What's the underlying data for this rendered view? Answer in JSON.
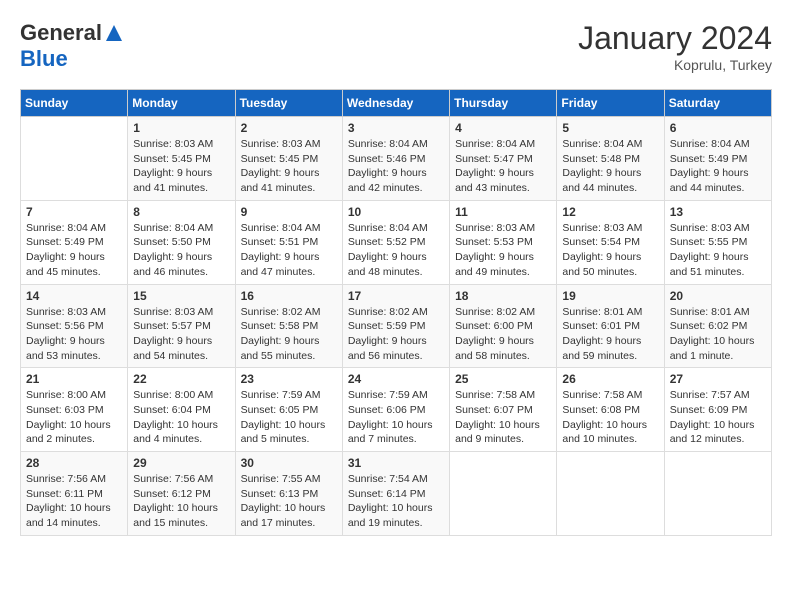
{
  "logo": {
    "general": "General",
    "blue": "Blue"
  },
  "header": {
    "month_year": "January 2024",
    "location": "Koprulu, Turkey"
  },
  "days_of_week": [
    "Sunday",
    "Monday",
    "Tuesday",
    "Wednesday",
    "Thursday",
    "Friday",
    "Saturday"
  ],
  "weeks": [
    [
      {
        "day": "",
        "sunrise": "",
        "sunset": "",
        "daylight": ""
      },
      {
        "day": "1",
        "sunrise": "Sunrise: 8:03 AM",
        "sunset": "Sunset: 5:45 PM",
        "daylight": "Daylight: 9 hours and 41 minutes."
      },
      {
        "day": "2",
        "sunrise": "Sunrise: 8:03 AM",
        "sunset": "Sunset: 5:45 PM",
        "daylight": "Daylight: 9 hours and 41 minutes."
      },
      {
        "day": "3",
        "sunrise": "Sunrise: 8:04 AM",
        "sunset": "Sunset: 5:46 PM",
        "daylight": "Daylight: 9 hours and 42 minutes."
      },
      {
        "day": "4",
        "sunrise": "Sunrise: 8:04 AM",
        "sunset": "Sunset: 5:47 PM",
        "daylight": "Daylight: 9 hours and 43 minutes."
      },
      {
        "day": "5",
        "sunrise": "Sunrise: 8:04 AM",
        "sunset": "Sunset: 5:48 PM",
        "daylight": "Daylight: 9 hours and 44 minutes."
      },
      {
        "day": "6",
        "sunrise": "Sunrise: 8:04 AM",
        "sunset": "Sunset: 5:49 PM",
        "daylight": "Daylight: 9 hours and 44 minutes."
      }
    ],
    [
      {
        "day": "7",
        "sunrise": "Sunrise: 8:04 AM",
        "sunset": "Sunset: 5:49 PM",
        "daylight": "Daylight: 9 hours and 45 minutes."
      },
      {
        "day": "8",
        "sunrise": "Sunrise: 8:04 AM",
        "sunset": "Sunset: 5:50 PM",
        "daylight": "Daylight: 9 hours and 46 minutes."
      },
      {
        "day": "9",
        "sunrise": "Sunrise: 8:04 AM",
        "sunset": "Sunset: 5:51 PM",
        "daylight": "Daylight: 9 hours and 47 minutes."
      },
      {
        "day": "10",
        "sunrise": "Sunrise: 8:04 AM",
        "sunset": "Sunset: 5:52 PM",
        "daylight": "Daylight: 9 hours and 48 minutes."
      },
      {
        "day": "11",
        "sunrise": "Sunrise: 8:03 AM",
        "sunset": "Sunset: 5:53 PM",
        "daylight": "Daylight: 9 hours and 49 minutes."
      },
      {
        "day": "12",
        "sunrise": "Sunrise: 8:03 AM",
        "sunset": "Sunset: 5:54 PM",
        "daylight": "Daylight: 9 hours and 50 minutes."
      },
      {
        "day": "13",
        "sunrise": "Sunrise: 8:03 AM",
        "sunset": "Sunset: 5:55 PM",
        "daylight": "Daylight: 9 hours and 51 minutes."
      }
    ],
    [
      {
        "day": "14",
        "sunrise": "Sunrise: 8:03 AM",
        "sunset": "Sunset: 5:56 PM",
        "daylight": "Daylight: 9 hours and 53 minutes."
      },
      {
        "day": "15",
        "sunrise": "Sunrise: 8:03 AM",
        "sunset": "Sunset: 5:57 PM",
        "daylight": "Daylight: 9 hours and 54 minutes."
      },
      {
        "day": "16",
        "sunrise": "Sunrise: 8:02 AM",
        "sunset": "Sunset: 5:58 PM",
        "daylight": "Daylight: 9 hours and 55 minutes."
      },
      {
        "day": "17",
        "sunrise": "Sunrise: 8:02 AM",
        "sunset": "Sunset: 5:59 PM",
        "daylight": "Daylight: 9 hours and 56 minutes."
      },
      {
        "day": "18",
        "sunrise": "Sunrise: 8:02 AM",
        "sunset": "Sunset: 6:00 PM",
        "daylight": "Daylight: 9 hours and 58 minutes."
      },
      {
        "day": "19",
        "sunrise": "Sunrise: 8:01 AM",
        "sunset": "Sunset: 6:01 PM",
        "daylight": "Daylight: 9 hours and 59 minutes."
      },
      {
        "day": "20",
        "sunrise": "Sunrise: 8:01 AM",
        "sunset": "Sunset: 6:02 PM",
        "daylight": "Daylight: 10 hours and 1 minute."
      }
    ],
    [
      {
        "day": "21",
        "sunrise": "Sunrise: 8:00 AM",
        "sunset": "Sunset: 6:03 PM",
        "daylight": "Daylight: 10 hours and 2 minutes."
      },
      {
        "day": "22",
        "sunrise": "Sunrise: 8:00 AM",
        "sunset": "Sunset: 6:04 PM",
        "daylight": "Daylight: 10 hours and 4 minutes."
      },
      {
        "day": "23",
        "sunrise": "Sunrise: 7:59 AM",
        "sunset": "Sunset: 6:05 PM",
        "daylight": "Daylight: 10 hours and 5 minutes."
      },
      {
        "day": "24",
        "sunrise": "Sunrise: 7:59 AM",
        "sunset": "Sunset: 6:06 PM",
        "daylight": "Daylight: 10 hours and 7 minutes."
      },
      {
        "day": "25",
        "sunrise": "Sunrise: 7:58 AM",
        "sunset": "Sunset: 6:07 PM",
        "daylight": "Daylight: 10 hours and 9 minutes."
      },
      {
        "day": "26",
        "sunrise": "Sunrise: 7:58 AM",
        "sunset": "Sunset: 6:08 PM",
        "daylight": "Daylight: 10 hours and 10 minutes."
      },
      {
        "day": "27",
        "sunrise": "Sunrise: 7:57 AM",
        "sunset": "Sunset: 6:09 PM",
        "daylight": "Daylight: 10 hours and 12 minutes."
      }
    ],
    [
      {
        "day": "28",
        "sunrise": "Sunrise: 7:56 AM",
        "sunset": "Sunset: 6:11 PM",
        "daylight": "Daylight: 10 hours and 14 minutes."
      },
      {
        "day": "29",
        "sunrise": "Sunrise: 7:56 AM",
        "sunset": "Sunset: 6:12 PM",
        "daylight": "Daylight: 10 hours and 15 minutes."
      },
      {
        "day": "30",
        "sunrise": "Sunrise: 7:55 AM",
        "sunset": "Sunset: 6:13 PM",
        "daylight": "Daylight: 10 hours and 17 minutes."
      },
      {
        "day": "31",
        "sunrise": "Sunrise: 7:54 AM",
        "sunset": "Sunset: 6:14 PM",
        "daylight": "Daylight: 10 hours and 19 minutes."
      },
      {
        "day": "",
        "sunrise": "",
        "sunset": "",
        "daylight": ""
      },
      {
        "day": "",
        "sunrise": "",
        "sunset": "",
        "daylight": ""
      },
      {
        "day": "",
        "sunrise": "",
        "sunset": "",
        "daylight": ""
      }
    ]
  ]
}
